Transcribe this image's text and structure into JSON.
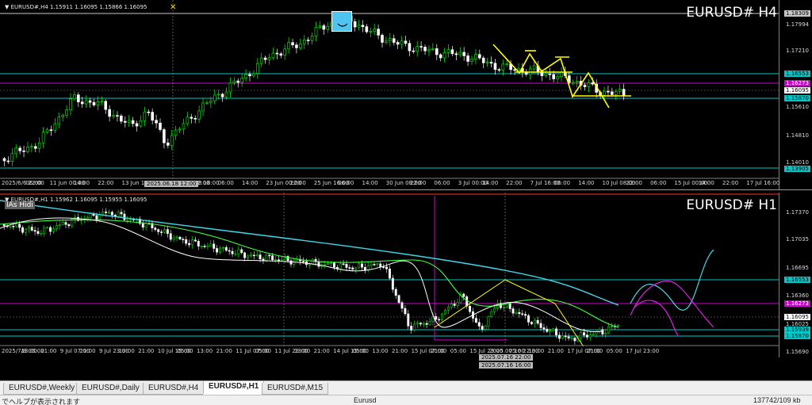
{
  "h4": {
    "info": "▼ EURUSD#,H4  1.15911 1.16095 1.15866 1.16095",
    "label": "EURUSD# H4",
    "price_ticks": [
      "1.17994",
      "1.17210",
      "1.16095",
      "1.15610",
      "1.14810",
      "1.14010"
    ],
    "price_tags": [
      {
        "text": "1.18309",
        "color": "#c8c8c8",
        "text_color": "#000"
      },
      {
        "text": "1.16553",
        "color": "#00c8c8",
        "text_color": "#000"
      },
      {
        "text": "1.16273",
        "color": "#d000d0",
        "text_color": "#fff"
      },
      {
        "text": "1.16095",
        "color": "#ffffff",
        "text_color": "#000"
      },
      {
        "text": "1.15870",
        "color": "#00c8c8",
        "text_color": "#000"
      },
      {
        "text": "1.13905",
        "color": "#00c8c8",
        "text_color": "#000"
      }
    ],
    "time_labels": [
      "2025/6/6 22:00",
      "06:00",
      "11 Jun 00:00",
      "14:00",
      "22:00",
      "13 Jun 16:00",
      "06:00",
      "2025.06.18 18:00",
      "22:00",
      "06:00",
      "14:00",
      "23 Jun 00:00",
      "22:00",
      "25 Jun 16:00",
      "06:00",
      "14:00",
      "30 Jun 08:00",
      "22:00",
      "06:00",
      "3 Jul 00:00",
      "14:00",
      "22:00",
      "7 Jul 16:00",
      "06:00",
      "14:00",
      "10 Jul 08:00",
      "22:00",
      "06:00",
      "15 Jul 00:00",
      "14:00",
      "22:00",
      "17 Jul 16:00"
    ],
    "crosshair_time": "2025.06.18 12:00"
  },
  "h1": {
    "info": "▼ EURUSD#,H1  1.15962 1.16095 1.15955 1.16095",
    "ias": "IAs Hidi",
    "label": "EURUSD# H1",
    "price_ticks": [
      "1.17370",
      "1.17035",
      "1.16695",
      "1.16360",
      "1.16025",
      "1.15690"
    ],
    "price_tags": [
      {
        "text": "1.16553",
        "color": "#00c8c8",
        "text_color": "#000"
      },
      {
        "text": "1.16273",
        "color": "#d000d0",
        "text_color": "#fff"
      },
      {
        "text": "1.16095",
        "color": "#ffffff",
        "text_color": "#000"
      },
      {
        "text": "1.15939",
        "color": "#00c8c8",
        "text_color": "#000"
      },
      {
        "text": "1.15870",
        "color": "#00c8c8",
        "text_color": "#000"
      }
    ],
    "time_labels": [
      "2025/7/8 05:00",
      "13:00",
      "21:00",
      "9 Jul 07:00",
      "21:00",
      "9 Jul 23:00",
      "13:00",
      "21:00",
      "10 Jul 15:00",
      "05:00",
      "13:00",
      "21:00",
      "11 Jul 07:00",
      "05:00",
      "11 Jul 23:00",
      "13:00",
      "21:00",
      "14 Jul 15:00",
      "05:00",
      "13:00",
      "21:00",
      "15 Jul 07:00",
      "21:00",
      "05:00",
      "15 Jul 23:00",
      "2025.07.16 22:00",
      "05:00",
      "13:00",
      "21:00",
      "17 Jul 07:00",
      "21:00",
      "05:00",
      "17 Jul 23:00"
    ],
    "crosshair_time_a": "2025.07.16 22:00",
    "crosshair_time_b": "2025.07.16 16:00"
  },
  "tabs": [
    {
      "label": "EURUSD#,Weekly",
      "active": false
    },
    {
      "label": "EURUSD#,Daily",
      "active": false
    },
    {
      "label": "EURUSD#,H4",
      "active": false
    },
    {
      "label": "EURUSD#,H1",
      "active": true
    },
    {
      "label": "EURUSD#,M15",
      "active": false
    }
  ],
  "status": {
    "help": "でヘルプが表示されます",
    "symbol": "Eurusd",
    "traffic": "137742/109 kb"
  },
  "colors": {
    "bull": "#00ff00",
    "bear": "#ffffff",
    "cyan_level": "#00c8c8",
    "magenta_level": "#d000d0",
    "yellow_drawing": "#ffff00"
  }
}
